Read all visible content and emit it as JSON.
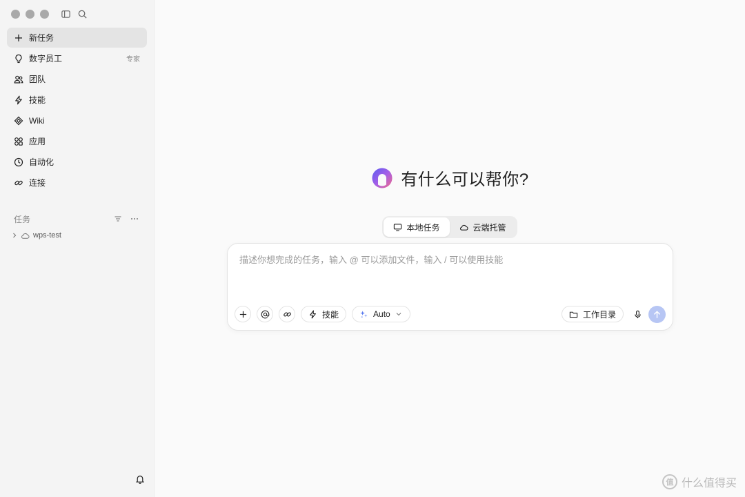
{
  "sidebar": {
    "nav": [
      {
        "label": "新任务",
        "icon": "plus-icon",
        "active": true
      },
      {
        "label": "数字员工",
        "icon": "lightbulb-icon",
        "tag": "专家"
      },
      {
        "label": "团队",
        "icon": "team-icon"
      },
      {
        "label": "技能",
        "icon": "lightning-icon"
      },
      {
        "label": "Wiki",
        "icon": "wiki-icon"
      },
      {
        "label": "应用",
        "icon": "apps-icon"
      },
      {
        "label": "自动化",
        "icon": "clock-icon"
      },
      {
        "label": "连接",
        "icon": "link-icon"
      }
    ],
    "tasks_section": {
      "title": "任务",
      "items": [
        {
          "label": "wps-test",
          "icon": "cloud-icon"
        }
      ]
    }
  },
  "main": {
    "greeting": "有什么可以帮你?",
    "modes": [
      {
        "label": "本地任务",
        "icon": "monitor-icon",
        "active": true
      },
      {
        "label": "云端托管",
        "icon": "cloud-icon",
        "active": false
      }
    ],
    "composer": {
      "placeholder": "描述你想完成的任务，输入 @ 可以添加文件，输入 / 可以使用技能",
      "value": "",
      "skills_label": "技能",
      "model_label": "Auto",
      "workdir_label": "工作目录"
    }
  },
  "watermark": {
    "logo_text": "值",
    "text": "什么值得买"
  },
  "colors": {
    "send_button": "#b7c6f4",
    "sidebar_bg": "#f4f4f4",
    "main_bg": "#fafafa",
    "active_nav_bg": "#e4e4e4"
  }
}
